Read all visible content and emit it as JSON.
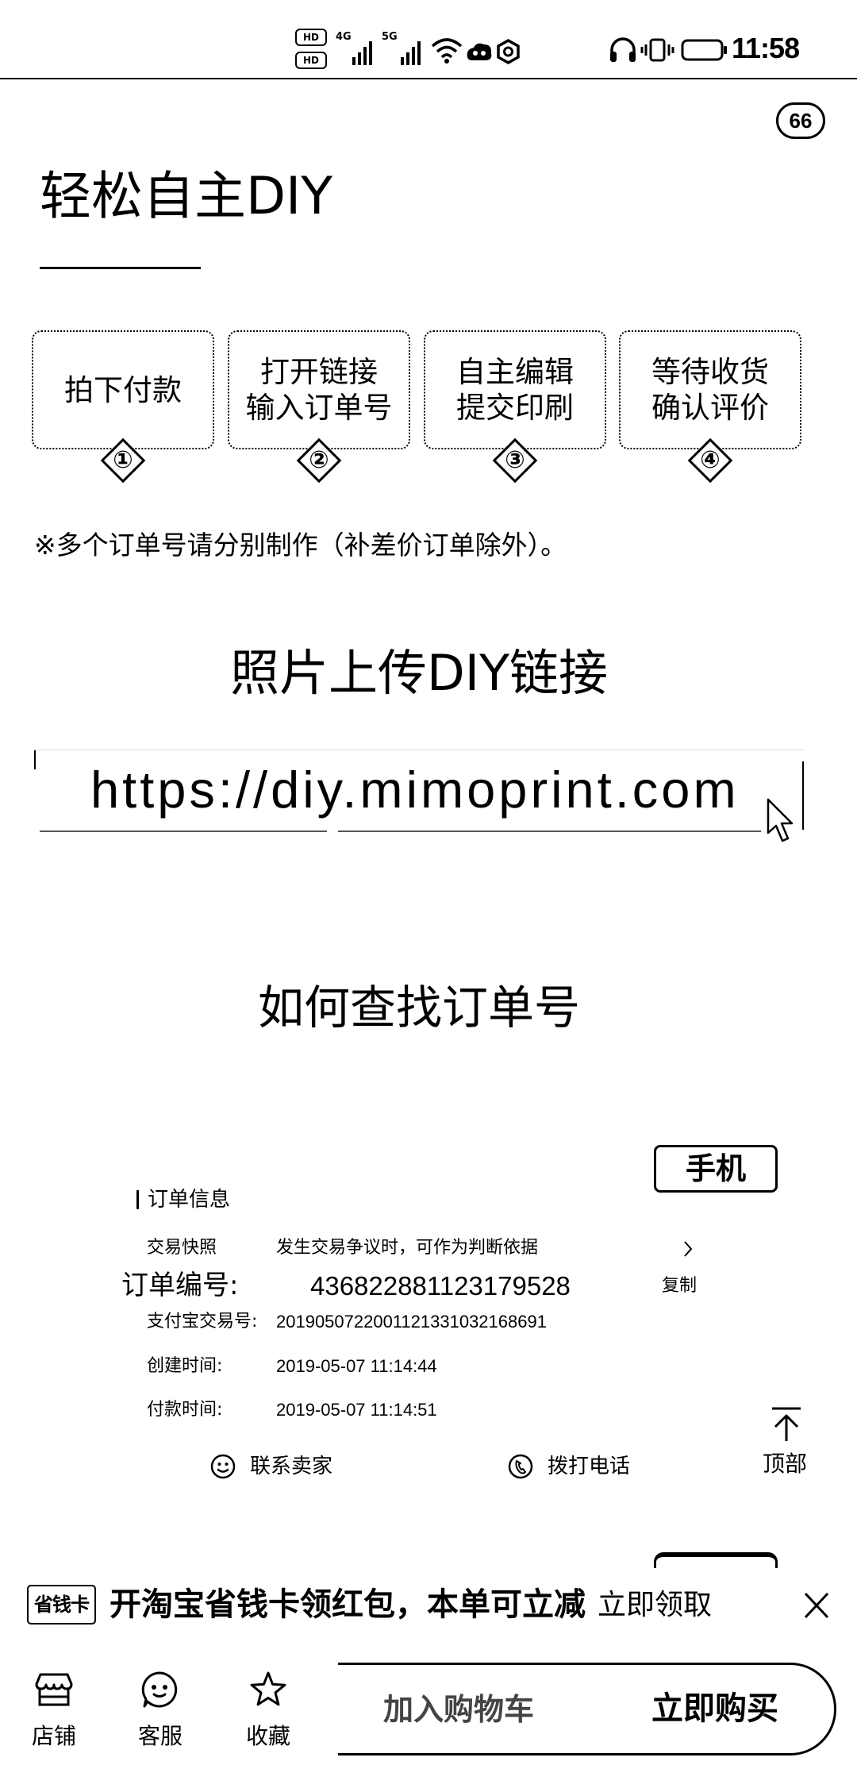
{
  "status_bar": {
    "hd_badges": [
      "HD",
      "HD"
    ],
    "network_labels": [
      "4G",
      "5G"
    ],
    "time": "11:58",
    "icons": [
      "hd-icon",
      "signal-icon",
      "wifi-icon",
      "app-notification-icon",
      "hexagon-status-icon",
      "headphones-icon",
      "vibrate-icon",
      "battery-icon"
    ]
  },
  "read_badge": "66",
  "hero": {
    "title": "轻松自主DIY"
  },
  "steps": [
    {
      "number": "①",
      "lines": [
        "拍下付款"
      ]
    },
    {
      "number": "②",
      "lines": [
        "打开链接",
        "输入订单号"
      ]
    },
    {
      "number": "③",
      "lines": [
        "自主编辑",
        "提交印刷"
      ]
    },
    {
      "number": "④",
      "lines": [
        "等待收货",
        "确认评价"
      ]
    }
  ],
  "note": "※多个订单号请分别制作（补差价订单除外）。",
  "upload": {
    "title": "照片上传DIY链接",
    "url": "https://diy.mimoprint.com"
  },
  "howto": {
    "title": "如何查找订单号"
  },
  "order_example": {
    "device_tag": "手机",
    "section_title": "订单信息",
    "snapshot": {
      "label": "交易快照",
      "value": "发生交易争议时，可作为判断依据"
    },
    "order_no": {
      "label": "订单编号:",
      "value": "436822881123179528",
      "copy": "复制"
    },
    "alipay_no": {
      "label": "支付宝交易号:",
      "value": "2019050722001121331032168691"
    },
    "created": {
      "label": "创建时间:",
      "value": "2019-05-07 11:14:44"
    },
    "paid": {
      "label": "付款时间:",
      "value": "2019-05-07 11:14:51"
    },
    "contact_seller": "联系卖家",
    "call_phone": "拨打电话"
  },
  "back_to_top": "顶部",
  "promo": {
    "badge": "省钱卡",
    "text": "开淘宝省钱卡领红包，本单可立减",
    "action": "立即领取"
  },
  "bottom_bar": {
    "shop": "店铺",
    "service": "客服",
    "favorite": "收藏",
    "add_to_cart": "加入购物车",
    "buy_now": "立即购买"
  },
  "colors": {
    "text": "#000000",
    "background": "#ffffff",
    "muted": "#444444"
  }
}
